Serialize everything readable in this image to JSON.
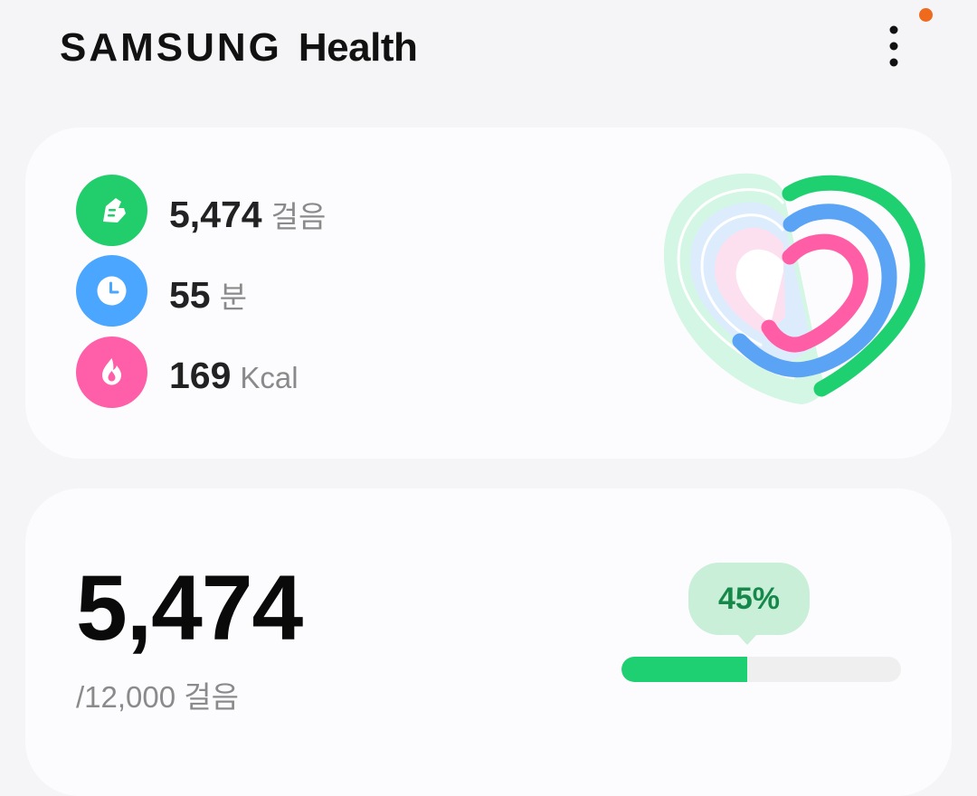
{
  "header": {
    "brand": "SAMSUNG",
    "app_name": "Health",
    "menu_icon": "more-vertical-icon",
    "notification_dot_color": "#f06a1e"
  },
  "summary": {
    "metrics": [
      {
        "value": "5,474",
        "unit": "걸음",
        "icon": "shoe-icon",
        "color": "#22cd6c"
      },
      {
        "value": "55",
        "unit": "분",
        "icon": "clock-icon",
        "color": "#4aa6ff"
      },
      {
        "value": "169",
        "unit": "Kcal",
        "icon": "flame-icon",
        "color": "#ff5fa8"
      }
    ],
    "heart_icon": "activity-heart-icon",
    "ring_colors": {
      "steps": "#1fd071",
      "active_time": "#5aa3f5",
      "calories": "#ff5ea6"
    }
  },
  "steps": {
    "count": "5,474",
    "goal_text": "/12,000 걸음",
    "progress_percent_label": "45%",
    "progress_fraction": 0.45,
    "accent": "#1ed071"
  }
}
